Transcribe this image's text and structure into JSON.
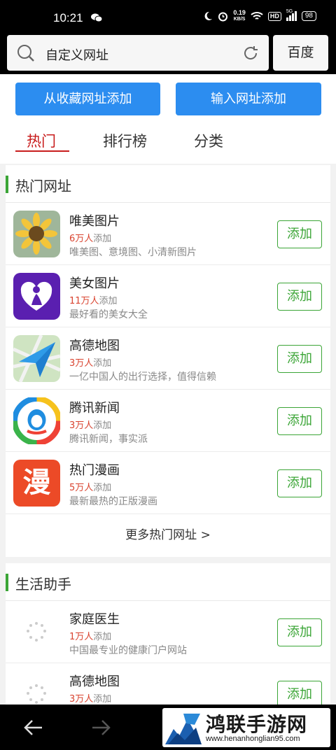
{
  "status_bar": {
    "time": "10:21",
    "net_speed": "0.19",
    "net_unit": "KB/S",
    "hd": "HD",
    "signal": "5G",
    "battery": "98"
  },
  "search": {
    "text": "自定义网址",
    "engine_label": "百度"
  },
  "actions": {
    "add_from_favorites": "从收藏网址添加",
    "add_by_url": "输入网址添加"
  },
  "tabs": [
    {
      "label": "热门",
      "active": true
    },
    {
      "label": "排行榜",
      "active": false
    },
    {
      "label": "分类",
      "active": false
    }
  ],
  "hot_section": {
    "title": "热门网址",
    "items": [
      {
        "name": "唯美图片",
        "count": "6万人",
        "suffix": "添加",
        "desc": "唯美图、意境图、小清新图片",
        "button": "添加",
        "icon": "sunflower-icon"
      },
      {
        "name": "美女图片",
        "count": "11万人",
        "suffix": "添加",
        "desc": "最好看的美女大全",
        "button": "添加",
        "icon": "beauty-icon"
      },
      {
        "name": "高德地图",
        "count": "3万人",
        "suffix": "添加",
        "desc": "一亿中国人的出行选择，值得信赖",
        "button": "添加",
        "icon": "amap-icon"
      },
      {
        "name": "腾讯新闻",
        "count": "3万人",
        "suffix": "添加",
        "desc": "腾讯新闻，事实派",
        "button": "添加",
        "icon": "tencent-news-icon"
      },
      {
        "name": "热门漫画",
        "count": "5万人",
        "suffix": "添加",
        "desc": "最新最热的正版漫画",
        "button": "添加",
        "icon": "manga-icon",
        "icon_char": "漫"
      }
    ],
    "more": "更多热门网址 >"
  },
  "life_section": {
    "title": "生活助手",
    "items": [
      {
        "name": "家庭医生",
        "count": "1万人",
        "suffix": "添加",
        "desc": "中国最专业的健康门户网站",
        "button": "添加",
        "icon": "loading-icon"
      },
      {
        "name": "高德地图",
        "count": "3万人",
        "suffix": "添加",
        "desc": "",
        "button": "添加",
        "icon": "loading-icon"
      }
    ]
  },
  "watermark": {
    "title": "鸿联手游网",
    "url": "www.henanhonglian95.com"
  },
  "colors": {
    "accent_blue": "#2c8df0",
    "accent_green": "#3ba536",
    "active_red": "#c81c1c",
    "count_red": "#d9432f"
  }
}
